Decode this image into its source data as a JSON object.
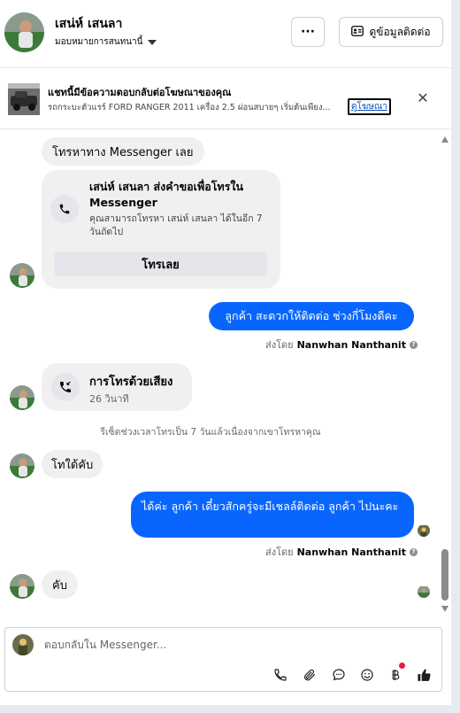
{
  "header": {
    "name": "เสน่ห์ เสนลา",
    "subtitle": "มอบหมายการสนทนานี้",
    "more_label": "···",
    "contact_label": "ดูข้อมูลติดต่อ"
  },
  "ad": {
    "title": "แชทนี้มีข้อความตอบกลับต่อโฆษณาของคุณ",
    "description": "รถกระบะตัวแรร์ FORD RANGER 2011 เครื่อง 2.5 ผ่อนสบายๆ เริ่มต้นเพียง...",
    "link": "ดูโฆษณา",
    "close": "✕"
  },
  "messages": {
    "m1": "โทรหาทาง Messenger เลย",
    "call_request": {
      "title": "เสน่ห์ เสนลา ส่งคำขอเพื่อโทรใน Messenger",
      "body": "คุณสามารถโทรหา เสน่ห์ เสนลา ได้ในอีก 7 วันถัดไป",
      "button": "โทรเลย"
    },
    "m2": "ลูกค้า สะดวกให้ติดต่อ ช่วงกี่โมงดีคะ",
    "sent_by_prefix": "ส่งโดย",
    "sent_by_name": "Nanwhan Nanthanit",
    "voice_call": {
      "title": "การโทรด้วยเสียง",
      "duration": "26 วินาที"
    },
    "system_note": "รีเซ็ตช่วงเวลาโทรเป็น 7 วันแล้วเนื่องจากเขาโทรหาคุณ",
    "m3": "โทใด้คับ",
    "m4": "ได้ค่ะ  ลูกค้า  เดี๋ยวสักครู่จะมีเชลล์ติดต่อ ลูกค้า ไปนะคะ",
    "m5": "คับ"
  },
  "composer": {
    "placeholder": "ตอบกลับใน Messenger..."
  },
  "icons": {
    "phone": "phone-icon",
    "attach": "paperclip-icon",
    "chat": "chat-bubble-icon",
    "emoji": "smiley-icon",
    "baht": "baht-icon",
    "like": "thumbs-up-icon"
  },
  "colors": {
    "outgoing_bubble": "#0866ff",
    "incoming_bubble": "#f0f0f0",
    "link": "#0b4fb7",
    "notification_dot": "#e41e3f"
  }
}
